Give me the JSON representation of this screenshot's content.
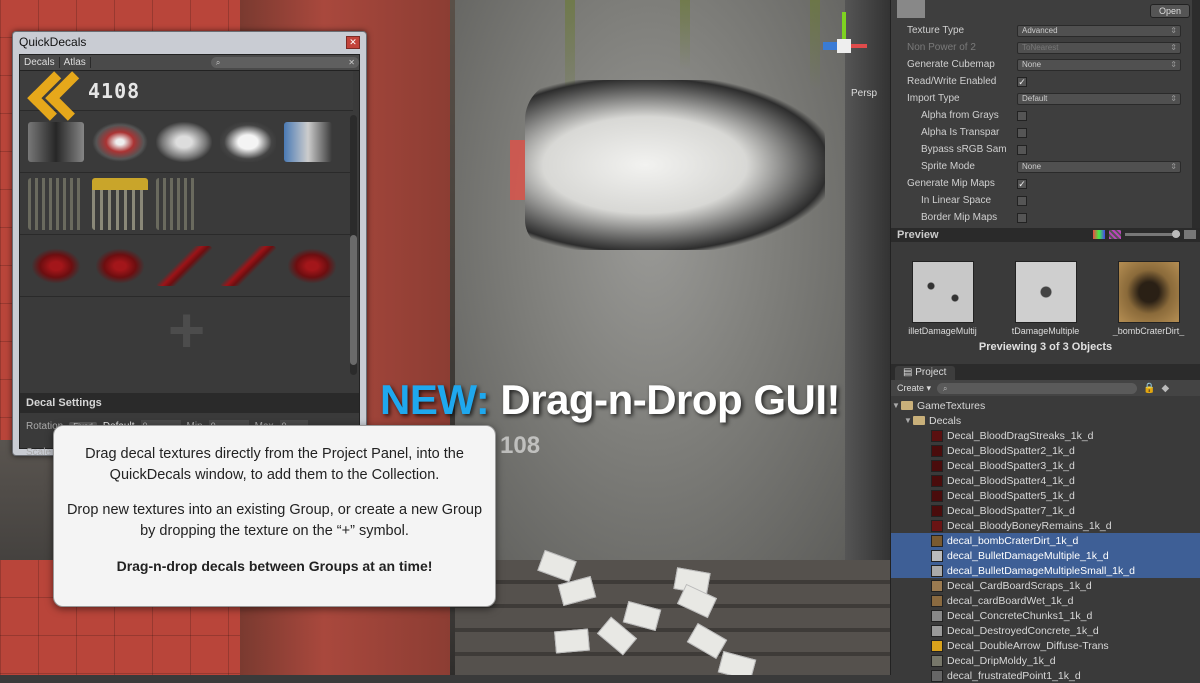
{
  "headline": {
    "new": "NEW:",
    "text": " Drag-n-Drop GUI!"
  },
  "gizmo": {
    "label": "Persp"
  },
  "ghost_text": "108",
  "quickdecals": {
    "title": "QuickDecals",
    "tabs": [
      "Decals",
      "Atlas"
    ],
    "search_placeholder": "",
    "header_number": "4108",
    "settings_header": "Decal Settings",
    "settings": {
      "rotation_label": "Rotation",
      "rotation_mode": "Fixed",
      "default_label": "Default",
      "default_value": "0",
      "min_label": "Min",
      "min_value": "0",
      "max_label": "Max",
      "max_value": "0",
      "scale_label": "Scale"
    }
  },
  "callout": {
    "p1": "Drag decal textures directly from the Project Panel, into the QuickDecals window, to add them to the Collection.",
    "p2": "Drop new textures into an existing Group, or create a new Group by dropping the texture on the “+” symbol.",
    "p3": "Drag-n-drop decals between Groups at an time!"
  },
  "inspector": {
    "open_label": "Open",
    "props": [
      {
        "label": "Texture Type",
        "value": "Advanced",
        "dim": false,
        "indent": false,
        "kind": "dropdown"
      },
      {
        "label": "Non Power of 2",
        "value": "ToNearest",
        "dim": true,
        "indent": false,
        "kind": "dropdown"
      },
      {
        "label": "Generate Cubemap",
        "value": "None",
        "dim": false,
        "indent": false,
        "kind": "dropdown"
      },
      {
        "label": "Read/Write Enabled",
        "value": "✓",
        "dim": false,
        "indent": false,
        "kind": "check"
      },
      {
        "label": "Import Type",
        "value": "Default",
        "dim": false,
        "indent": false,
        "kind": "dropdown"
      },
      {
        "label": "Alpha from Grays",
        "value": "",
        "dim": false,
        "indent": true,
        "kind": "check"
      },
      {
        "label": "Alpha Is Transpar",
        "value": "",
        "dim": false,
        "indent": true,
        "kind": "check"
      },
      {
        "label": "Bypass sRGB Sam",
        "value": "",
        "dim": false,
        "indent": true,
        "kind": "check"
      },
      {
        "label": "Sprite Mode",
        "value": "None",
        "dim": false,
        "indent": true,
        "kind": "dropdown"
      },
      {
        "label": "Generate Mip Maps",
        "value": "✓",
        "dim": false,
        "indent": false,
        "kind": "check"
      },
      {
        "label": "In Linear Space",
        "value": "",
        "dim": false,
        "indent": true,
        "kind": "check"
      },
      {
        "label": "Border Mip Maps",
        "value": "",
        "dim": false,
        "indent": true,
        "kind": "check"
      }
    ]
  },
  "preview": {
    "title": "Preview",
    "items": [
      "illetDamageMultij",
      "tDamageMultiple",
      "_bombCraterDirt_"
    ],
    "count_text": "Previewing 3 of 3 Objects"
  },
  "project": {
    "tab": "Project",
    "create_label": "Create",
    "folders": [
      "GameTextures",
      "Decals"
    ],
    "files": [
      {
        "name": "Decal_BloodDragStreaks_1k_d",
        "selected": false,
        "color": "#5a1010"
      },
      {
        "name": "Decal_BloodSpatter2_1k_d",
        "selected": false,
        "color": "#4a0c0c"
      },
      {
        "name": "Decal_BloodSpatter3_1k_d",
        "selected": false,
        "color": "#4a0c0c"
      },
      {
        "name": "Decal_BloodSpatter4_1k_d",
        "selected": false,
        "color": "#4a0c0c"
      },
      {
        "name": "Decal_BloodSpatter5_1k_d",
        "selected": false,
        "color": "#4a0c0c"
      },
      {
        "name": "Decal_BloodSpatter7_1k_d",
        "selected": false,
        "color": "#4a0c0c"
      },
      {
        "name": "Decal_BloodyBoneyRemains_1k_d",
        "selected": false,
        "color": "#6a1414"
      },
      {
        "name": "decal_bombCraterDirt_1k_d",
        "selected": true,
        "color": "#7a5a30"
      },
      {
        "name": "decal_BulletDamageMultiple_1k_d",
        "selected": true,
        "color": "#bbbbbb"
      },
      {
        "name": "decal_BulletDamageMultipleSmall_1k_d",
        "selected": true,
        "color": "#aaaaaa"
      },
      {
        "name": "Decal_CardBoardScraps_1k_d",
        "selected": false,
        "color": "#9a7a50"
      },
      {
        "name": "decal_cardBoardWet_1k_d",
        "selected": false,
        "color": "#8a6a40"
      },
      {
        "name": "Decal_ConcreteChunks1_1k_d",
        "selected": false,
        "color": "#888888"
      },
      {
        "name": "Decal_DestroyedConcrete_1k_d",
        "selected": false,
        "color": "#999999"
      },
      {
        "name": "Decal_DoubleArrow_Diffuse-Trans",
        "selected": false,
        "color": "#d9a21c"
      },
      {
        "name": "Decal_DripMoldy_1k_d",
        "selected": false,
        "color": "#77776a"
      },
      {
        "name": "decal_frustratedPoint1_1k_d",
        "selected": false,
        "color": "#666666"
      }
    ]
  }
}
